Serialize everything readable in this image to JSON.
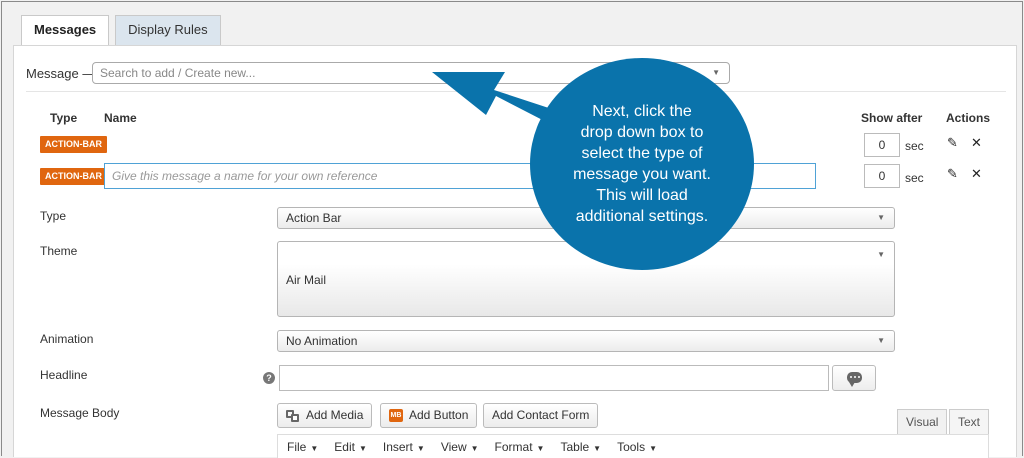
{
  "tabs": [
    {
      "label": "Messages",
      "active": true
    },
    {
      "label": "Display Rules",
      "active": false
    }
  ],
  "message_select": {
    "label": "Message —",
    "placeholder": "Search to add / Create new..."
  },
  "table": {
    "headers": {
      "type": "Type",
      "name": "Name",
      "show_after": "Show after",
      "actions": "Actions"
    },
    "rows": [
      {
        "badge": "ACTION-BAR",
        "name": "",
        "name_placeholder": "",
        "delay": "0",
        "unit": "sec"
      },
      {
        "badge": "ACTION-BAR",
        "name": "",
        "name_placeholder": "Give this message a name for your own reference",
        "delay": "0",
        "unit": "sec"
      }
    ],
    "icons": {
      "edit": "pencil-icon",
      "delete": "close-icon"
    }
  },
  "settings": {
    "type": {
      "label": "Type",
      "value": "Action Bar"
    },
    "theme": {
      "label": "Theme",
      "value": "Air Mail"
    },
    "animation": {
      "label": "Animation",
      "value": "No Animation"
    },
    "headline": {
      "label": "Headline",
      "help": "?",
      "value": ""
    },
    "message_body": {
      "label": "Message Body"
    }
  },
  "editor": {
    "buttons": {
      "add_media": "Add Media",
      "add_button": "Add Button",
      "add_contact_form": "Add Contact Form"
    },
    "mb_icon_text": "MB",
    "tabs": {
      "visual": "Visual",
      "text": "Text"
    },
    "menu": [
      "File",
      "Edit",
      "Insert",
      "View",
      "Format",
      "Table",
      "Tools"
    ]
  },
  "callout": {
    "lines": [
      "Next, click the",
      "drop down box to",
      "select the type of",
      "message you want.",
      "This will load",
      "additional settings."
    ]
  },
  "colors": {
    "badge": "#e0660f",
    "callout": "#0a73ab",
    "focus_border": "#4fa2d6"
  }
}
